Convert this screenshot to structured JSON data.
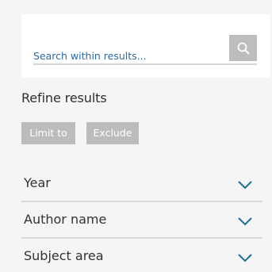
{
  "search": {
    "placeholder": "Search within results..."
  },
  "refine": {
    "title": "Refine results",
    "limit_label": "Limit to",
    "exclude_label": "Exclude"
  },
  "facets": [
    {
      "label": "Year"
    },
    {
      "label": "Author name"
    },
    {
      "label": "Subject area"
    }
  ],
  "colors": {
    "accent": "#1f6e98",
    "chip_bg": "#bcbcbc",
    "search_button_bg": "#bdbdbd"
  },
  "icons": {
    "search": "search-icon",
    "chevron": "chevron-down-icon"
  }
}
